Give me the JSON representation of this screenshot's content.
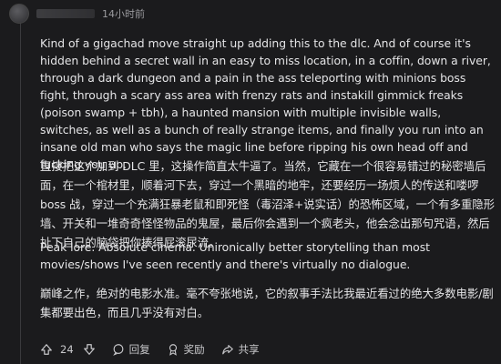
{
  "comment": {
    "timestamp": "14小时前",
    "paragraphs": [
      "Kind of a gigachad move straight up adding this to the dlc. And of course it's hidden behind a secret wall in an easy to miss location, in a coffin, down a river, through a dark dungeon and a pain in the ass teleporting with minions boss fight, through a scary ass area with frenzy rats and instakill gimmick freaks (poison swamp + tbh), a haunted mansion with multiple invisible walls, switches, as well as a bunch of really strange items, and finally you run into an insane old man who says the magic line before ripping his own head off and fucking you up.",
      "直接把这个加到 DLC 里，这操作简直太牛逼了。当然，它藏在一个很容易错过的秘密墙后面，在一个棺材里，顺着河下去，穿过一个黑暗的地牢，还要经历一场烦人的传送和喽啰 boss 战，穿过一个充满狂暴老鼠和即死怪（毒沼泽+说实话）的恐怖区域，一个有多重隐形墙、开关和一堆奇奇怪怪物品的鬼屋，最后你会遇到一个疯老头，他会念出那句咒语，然后扯下自己的脑袋把你揍得屁滚尿流。",
      "Peak lore. Absolute cinema. Unironically better storytelling than most movies/shows I've seen recently and there's virtually no dialogue.",
      "巅峰之作，绝对的电影水准。毫不夸张地说，它的叙事手法比我最近看过的绝大多数电影/剧集都要出色，而且几乎没有对白。"
    ]
  },
  "actions": {
    "vote_count": "24",
    "reply_label": "回复",
    "award_label": "奖励",
    "share_label": "共享"
  },
  "icons": {
    "upvote": "arrow-up-icon",
    "downvote": "arrow-down-icon",
    "reply": "speech-bubble-icon",
    "award": "award-icon",
    "share": "share-icon"
  },
  "colors": {
    "background": "#1b1b1d",
    "text": "#e4e4e6",
    "muted": "#9a9a9e"
  }
}
